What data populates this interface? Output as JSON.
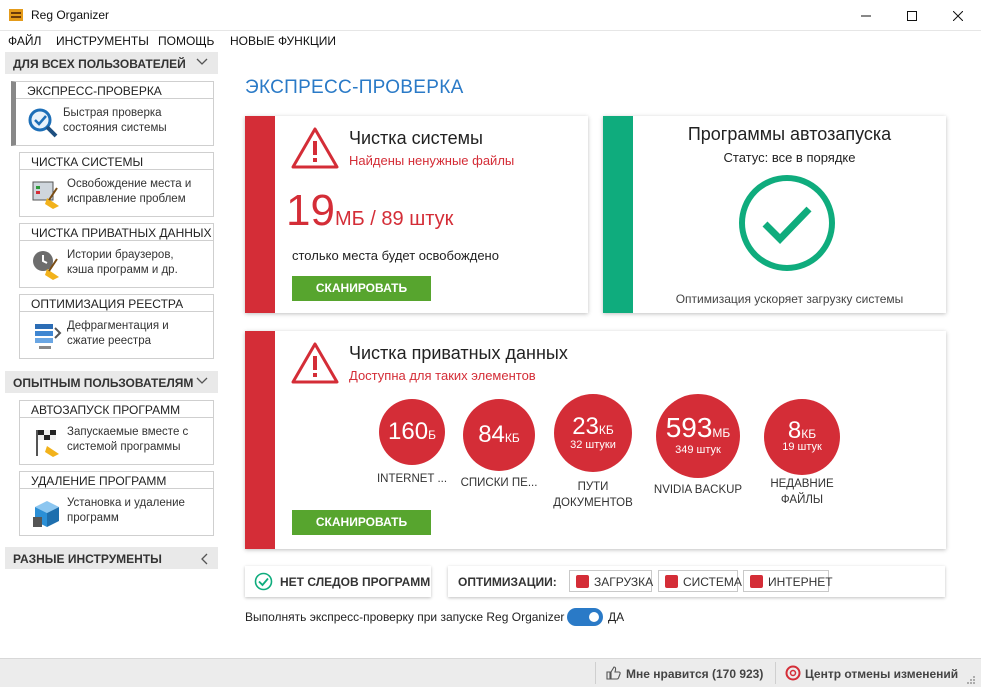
{
  "window": {
    "title": "Reg Organizer"
  },
  "menu": [
    "ФАЙЛ",
    "ИНСТРУМЕНТЫ",
    "ПОМОЩЬ",
    "НОВЫЕ ФУНКЦИИ"
  ],
  "sidebar": {
    "group_all": "ДЛЯ ВСЕХ ПОЛЬЗОВАТЕЛЕЙ",
    "group_adv": "ОПЫТНЫМ ПОЛЬЗОВАТЕЛЯМ",
    "group_misc": "РАЗНЫЕ ИНСТРУМЕНТЫ",
    "items": [
      {
        "title": "ЭКСПРЕСС-ПРОВЕРКА",
        "desc1": "Быстрая проверка",
        "desc2": "состояния системы",
        "icon": "magnifier-check-icon"
      },
      {
        "title": "ЧИСТКА СИСТЕМЫ",
        "desc1": "Освобождение места и",
        "desc2": "исправление проблем",
        "icon": "disk-broom-icon"
      },
      {
        "title": "ЧИСТКА ПРИВАТНЫХ ДАННЫХ",
        "desc1": "Истории браузеров,",
        "desc2": "кэша программ и др.",
        "icon": "private-broom-icon"
      },
      {
        "title": "ОПТИМИЗАЦИЯ РЕЕСТРА",
        "desc1": "Дефрагментация и",
        "desc2": "сжатие реестра",
        "icon": "registry-compress-icon"
      },
      {
        "title": "АВТОЗАПУСК ПРОГРАММ",
        "desc1": "Запускаемые вместе с",
        "desc2": "системой программы",
        "icon": "startup-flag-icon"
      },
      {
        "title": "УДАЛЕНИЕ ПРОГРАММ",
        "desc1": "Установка и удаление",
        "desc2": "программ",
        "icon": "box-trash-icon"
      }
    ]
  },
  "main": {
    "title": "ЭКСПРЕСС-ПРОВЕРКА",
    "system_clean": {
      "title": "Чистка системы",
      "subtitle": "Найдены ненужные файлы",
      "size": "19",
      "size_unit": "МБ / 89 штук",
      "note": "столько места будет освобождено",
      "button": "СКАНИРОВАТЬ"
    },
    "startup": {
      "title": "Программы автозапуска",
      "status": "Статус: все в порядке",
      "note": "Оптимизация ускоряет загрузку системы"
    },
    "private": {
      "title": "Чистка приватных данных",
      "subtitle": "Доступна для таких элементов",
      "button": "СКАНИРОВАТЬ",
      "items": [
        {
          "value": "160",
          "unit": "Б",
          "sub": "",
          "label1": "INTERNET ...",
          "label2": ""
        },
        {
          "value": "84",
          "unit": "КБ",
          "sub": "",
          "label1": "СПИСКИ ПЕ...",
          "label2": ""
        },
        {
          "value": "23",
          "unit": "КБ",
          "sub": "32 штуки",
          "label1": "ПУТИ",
          "label2": "ДОКУМЕНТОВ"
        },
        {
          "value": "593",
          "unit": "МБ",
          "sub": "349 штук",
          "label1": "NVIDIA BACKUP",
          "label2": ""
        },
        {
          "value": "8",
          "unit": "КБ",
          "sub": "19 штук",
          "label1": "НЕДАВНИЕ",
          "label2": "ФАЙЛЫ"
        }
      ]
    },
    "no_traces": "НЕТ СЛЕДОВ ПРОГРАММ",
    "optimizations_label": "ОПТИМИЗАЦИИ:",
    "optimizations": [
      "ЗАГРУЗКА",
      "СИСТЕМА",
      "ИНТЕРНЕТ"
    ],
    "autorun_label": "Выполнять экспресс-проверку при запуске Reg Organizer",
    "autorun_value": "ДА",
    "autorun_on": true
  },
  "statusbar": {
    "likes": "Мне нравится (170 923)",
    "undo": "Центр отмены изменений"
  },
  "colors": {
    "accent": "#2a7ac7",
    "danger": "#d42d37",
    "ok": "#0fac7d",
    "button": "#57a52e"
  }
}
